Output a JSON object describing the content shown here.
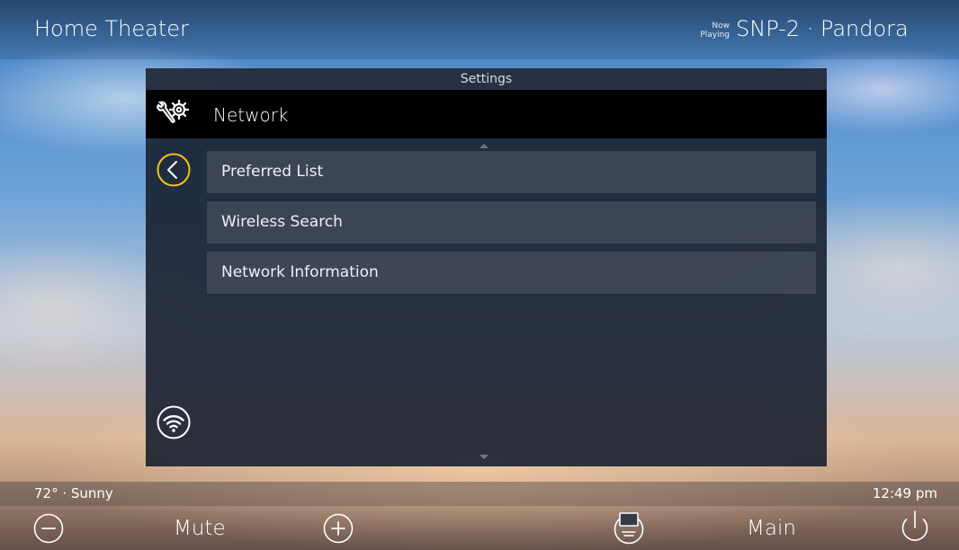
{
  "app": {
    "title": "Home Theater"
  },
  "now_playing": {
    "tag_line1": "Now",
    "tag_line2": "Playing",
    "source": "SNP-2 · Pandora"
  },
  "dialog": {
    "header": "Settings",
    "section_title": "Network",
    "section_icon": "tools-gear-icon",
    "back_icon": "chevron-left-circle-icon",
    "wifi_icon": "wifi-icon",
    "items": [
      {
        "label": "Preferred List"
      },
      {
        "label": "Wireless Search"
      },
      {
        "label": "Network Information"
      }
    ]
  },
  "status": {
    "weather": "72° · Sunny",
    "time": "12:49 pm"
  },
  "controls": {
    "volume_down_icon": "minus-circle-icon",
    "mute_label": "Mute",
    "volume_up_icon": "plus-circle-icon",
    "remote_icon": "remote-icon",
    "zone_label": "Main",
    "power_icon": "power-icon"
  },
  "colors": {
    "accent": "#f0c419",
    "dialog_bg": "#182030",
    "menu_item_bg": "#464e5e"
  }
}
